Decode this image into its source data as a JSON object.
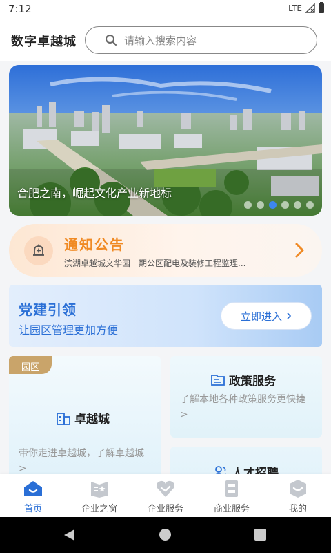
{
  "status_bar": {
    "time": "7:12",
    "network": "LTE"
  },
  "header": {
    "title": "数字卓越城",
    "search_placeholder": "请输入搜索内容"
  },
  "banner": {
    "caption": "合肥之南，崛起文化产业新地标",
    "slide_count": 6,
    "active_slide_index": 2,
    "active_dot_color": "#3d86f0"
  },
  "notice": {
    "title": "通知公告",
    "text": "滨湖卓越城文华园一期公区配电及装修工程监理..."
  },
  "party": {
    "title": "党建引领",
    "subtitle": "让园区管理更加方便",
    "button_label": "立即进入"
  },
  "cards": {
    "park": {
      "badge": "园区",
      "title": "卓越城",
      "description": "带你走进卓越城，了解卓越城 >"
    },
    "policy": {
      "title": "政策服务",
      "description": "了解本地各种政策服务更快捷 >"
    },
    "talent": {
      "title": "人才招聘"
    }
  },
  "tabs": [
    {
      "label": "首页",
      "icon": "home-icon",
      "active": true
    },
    {
      "label": "企业之窗",
      "icon": "enterprise-window-icon",
      "active": false
    },
    {
      "label": "企业服务",
      "icon": "enterprise-service-icon",
      "active": false
    },
    {
      "label": "商业服务",
      "icon": "commercial-service-icon",
      "active": false
    },
    {
      "label": "我的",
      "icon": "profile-icon",
      "active": false
    }
  ],
  "colors": {
    "accent_blue": "#2a6fd6",
    "notice_orange": "#f08a24",
    "badge_gold": "#c9a46a"
  }
}
